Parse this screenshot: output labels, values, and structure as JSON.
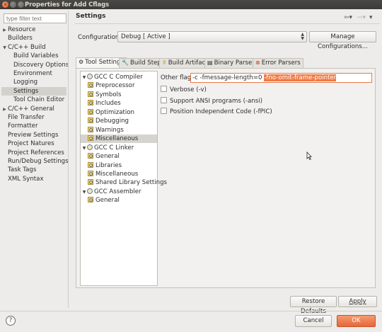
{
  "window": {
    "title": "Properties for Add Cflags"
  },
  "nav": {
    "filter_placeholder": "type filter text",
    "items": [
      {
        "label": "Resource",
        "expandable": true,
        "expanded": false,
        "indent": 0
      },
      {
        "label": "Builders",
        "expandable": false,
        "indent": 0
      },
      {
        "label": "C/C++ Build",
        "expandable": true,
        "expanded": true,
        "indent": 0
      },
      {
        "label": "Build Variables",
        "expandable": false,
        "indent": 1
      },
      {
        "label": "Discovery Options",
        "expandable": false,
        "indent": 1
      },
      {
        "label": "Environment",
        "expandable": false,
        "indent": 1
      },
      {
        "label": "Logging",
        "expandable": false,
        "indent": 1
      },
      {
        "label": "Settings",
        "expandable": false,
        "indent": 1,
        "selected": true
      },
      {
        "label": "Tool Chain Editor",
        "expandable": false,
        "indent": 1
      },
      {
        "label": "C/C++ General",
        "expandable": true,
        "expanded": false,
        "indent": 0
      },
      {
        "label": "File Transfer",
        "expandable": false,
        "indent": 0
      },
      {
        "label": "Formatter",
        "expandable": false,
        "indent": 0
      },
      {
        "label": "Preview Settings",
        "expandable": false,
        "indent": 0
      },
      {
        "label": "Project Natures",
        "expandable": false,
        "indent": 0
      },
      {
        "label": "Project References",
        "expandable": false,
        "indent": 0
      },
      {
        "label": "Run/Debug Settings",
        "expandable": false,
        "indent": 0
      },
      {
        "label": "Task Tags",
        "expandable": false,
        "indent": 0
      },
      {
        "label": "XML Syntax",
        "expandable": false,
        "indent": 0
      }
    ]
  },
  "page": {
    "title": "Settings",
    "configuration_label": "Configuration:",
    "configuration_value": "Debug  [ Active ]",
    "manage_button": "Manage Configurations..."
  },
  "tabs": [
    {
      "label": "Tool Settings",
      "icon": "tool-settings-icon",
      "active": true
    },
    {
      "label": "Build Steps",
      "icon": "build-steps-icon"
    },
    {
      "label": "Build Artifact",
      "icon": "build-artifact-icon"
    },
    {
      "label": "Binary Parsers",
      "icon": "binary-parsers-icon"
    },
    {
      "label": "Error Parsers",
      "icon": "error-parsers-icon"
    }
  ],
  "tool_tree": [
    {
      "label": "GCC C Compiler",
      "type": "tool",
      "indent": 0
    },
    {
      "label": "Preprocessor",
      "type": "category",
      "indent": 1
    },
    {
      "label": "Symbols",
      "type": "category",
      "indent": 1
    },
    {
      "label": "Includes",
      "type": "category",
      "indent": 1
    },
    {
      "label": "Optimization",
      "type": "category",
      "indent": 1
    },
    {
      "label": "Debugging",
      "type": "category",
      "indent": 1
    },
    {
      "label": "Warnings",
      "type": "category",
      "indent": 1
    },
    {
      "label": "Miscellaneous",
      "type": "category",
      "indent": 1,
      "selected": true
    },
    {
      "label": "GCC C Linker",
      "type": "tool",
      "indent": 0
    },
    {
      "label": "General",
      "type": "category",
      "indent": 1
    },
    {
      "label": "Libraries",
      "type": "category",
      "indent": 1
    },
    {
      "label": "Miscellaneous",
      "type": "category",
      "indent": 1
    },
    {
      "label": "Shared Library Settings",
      "type": "category",
      "indent": 1
    },
    {
      "label": "GCC Assembler",
      "type": "tool",
      "indent": 0
    },
    {
      "label": "General",
      "type": "category",
      "indent": 1
    }
  ],
  "options": {
    "other_flags_label": "Other flags",
    "other_flags_value_plain": "-c -fmessage-length=0 ",
    "other_flags_value_selected": "-fno-omit-frame-pointer",
    "checkboxes": [
      {
        "label": "Verbose (-v)",
        "checked": false
      },
      {
        "label": "Support ANSI programs (-ansi)",
        "checked": false
      },
      {
        "label": "Position Independent Code (-fPIC)",
        "checked": false
      }
    ]
  },
  "buttons": {
    "restore_defaults": "Restore Defaults",
    "apply": "Apply",
    "cancel": "Cancel",
    "ok": "OK"
  },
  "colors": {
    "accent": "#e8673a",
    "title_bar": "#3c3b37",
    "selection": "#ee7b47"
  }
}
